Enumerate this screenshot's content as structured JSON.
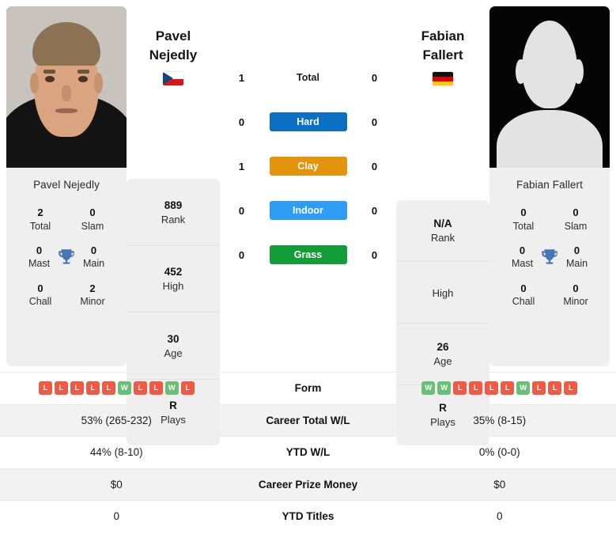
{
  "players": {
    "left": {
      "first_name": "Pavel",
      "last_name": "Nejedly",
      "full_name": "Pavel Nejedly",
      "flag": "cz-flag-icon",
      "country": "Czech Republic",
      "titles": {
        "total": {
          "value": "2",
          "label": "Total"
        },
        "slam": {
          "value": "0",
          "label": "Slam"
        },
        "mast": {
          "value": "0",
          "label": "Mast"
        },
        "main": {
          "value": "0",
          "label": "Main"
        },
        "chall": {
          "value": "0",
          "label": "Chall"
        },
        "minor": {
          "value": "2",
          "label": "Minor"
        }
      },
      "info": [
        {
          "value": "889",
          "label": "Rank"
        },
        {
          "value": "452",
          "label": "High"
        },
        {
          "value": "30",
          "label": "Age"
        },
        {
          "value": "R",
          "label": "Plays"
        }
      ],
      "form": [
        "L",
        "L",
        "L",
        "L",
        "L",
        "W",
        "L",
        "L",
        "W",
        "L"
      ],
      "career_total_wl": "53% (265-232)",
      "ytd_wl": "44% (8-10)",
      "career_prize_money": "$0",
      "ytd_titles": "0"
    },
    "right": {
      "first_name": "Fabian",
      "last_name": "Fallert",
      "full_name": "Fabian Fallert",
      "flag": "de-flag-icon",
      "country": "Germany",
      "titles": {
        "total": {
          "value": "0",
          "label": "Total"
        },
        "slam": {
          "value": "0",
          "label": "Slam"
        },
        "mast": {
          "value": "0",
          "label": "Mast"
        },
        "main": {
          "value": "0",
          "label": "Main"
        },
        "chall": {
          "value": "0",
          "label": "Chall"
        },
        "minor": {
          "value": "0",
          "label": "Minor"
        }
      },
      "info": [
        {
          "value": "N/A",
          "label": "Rank"
        },
        {
          "value": "",
          "label": "High"
        },
        {
          "value": "26",
          "label": "Age"
        },
        {
          "value": "R",
          "label": "Plays"
        }
      ],
      "form": [
        "W",
        "W",
        "L",
        "L",
        "L",
        "L",
        "W",
        "L",
        "L",
        "L"
      ],
      "career_total_wl": "35% (8-15)",
      "ytd_wl": "0% (0-0)",
      "career_prize_money": "$0",
      "ytd_titles": "0"
    }
  },
  "head_to_head": [
    {
      "label": "Total",
      "left": "1",
      "right": "0",
      "color": "",
      "style": "plain"
    },
    {
      "label": "Hard",
      "left": "0",
      "right": "0",
      "color": "#0b6fc4",
      "style": "pill"
    },
    {
      "label": "Clay",
      "left": "1",
      "right": "0",
      "color": "#e3940d",
      "style": "pill"
    },
    {
      "label": "Indoor",
      "left": "0",
      "right": "0",
      "color": "#2e9df5",
      "style": "pill"
    },
    {
      "label": "Grass",
      "left": "0",
      "right": "0",
      "color": "#139c38",
      "style": "pill"
    }
  ],
  "stats_table": {
    "rows": [
      {
        "label": "Form",
        "left": "",
        "right": "",
        "type": "form",
        "alt": false
      },
      {
        "label": "Career Total W/L",
        "left": "53% (265-232)",
        "right": "35% (8-15)",
        "type": "text",
        "alt": true
      },
      {
        "label": "YTD W/L",
        "left": "44% (8-10)",
        "right": "0% (0-0)",
        "type": "text",
        "alt": false
      },
      {
        "label": "Career Prize Money",
        "left": "$0",
        "right": "$0",
        "type": "text",
        "alt": true
      },
      {
        "label": "YTD Titles",
        "left": "0",
        "right": "0",
        "type": "text",
        "alt": false
      }
    ]
  },
  "colors": {
    "win_badge": "#6abf76",
    "loss_badge": "#f05a45",
    "card_bg": "#efefef",
    "alt_row_bg": "#f2f2f2",
    "trophy": "#4577b8"
  },
  "icons": {
    "trophy": "trophy-icon"
  }
}
